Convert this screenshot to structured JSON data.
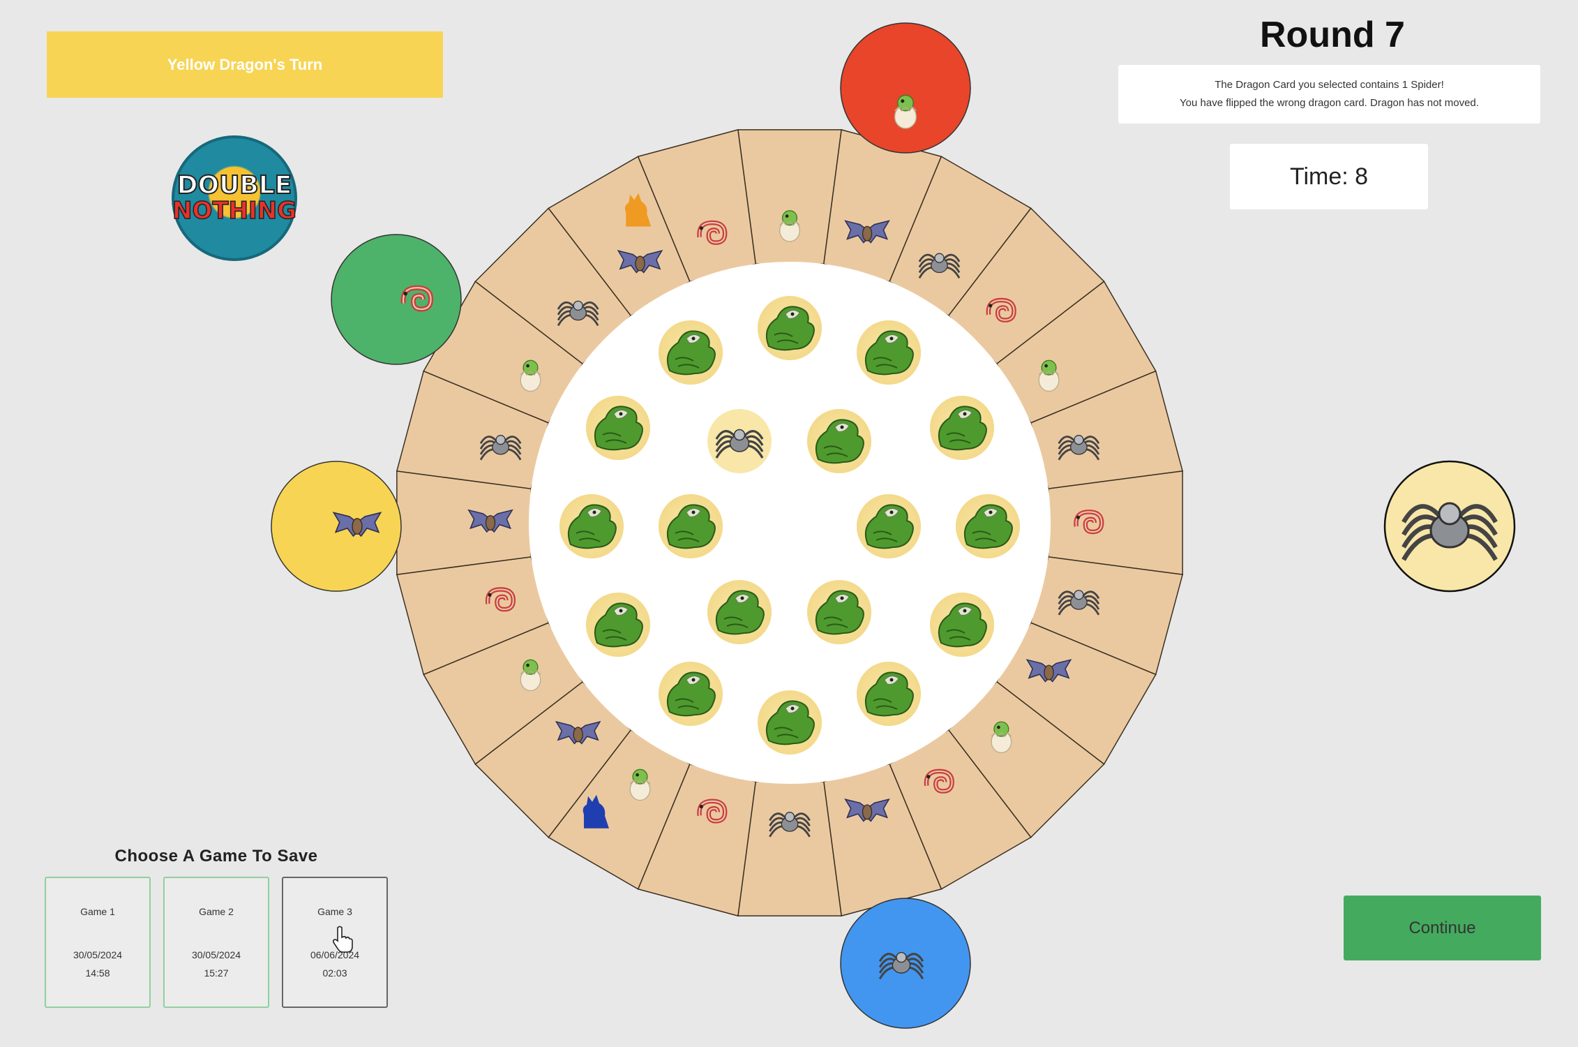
{
  "turn_banner": "Yellow Dragon's Turn",
  "round_title": "Round 7",
  "message": {
    "line1": "The Dragon Card you selected contains 1 Spider!",
    "line2": "You have flipped the wrong dragon card. Dragon has not moved."
  },
  "timer": "Time: 8",
  "continue_label": "Continue",
  "logo": {
    "line1": "DOUBLE",
    "line2": "NOTHING"
  },
  "save": {
    "title": "Choose A Game To Save",
    "games": [
      {
        "name": "Game 1",
        "date": "30/05/2024",
        "time": "14:58"
      },
      {
        "name": "Game 2",
        "date": "30/05/2024",
        "time": "15:27"
      },
      {
        "name": "Game 3",
        "date": "06/06/2024",
        "time": "02:03"
      }
    ]
  },
  "colors": {
    "background": "#e8e8e8",
    "banner_yellow": "#f7d453",
    "board_tile": "#ebc9a0",
    "red_player": "#e8452a",
    "green_player": "#4db36a",
    "yellow_player": "#f7d453",
    "blue_player": "#4296f0",
    "continue_green": "#44aa5e"
  },
  "board": {
    "ring_tiles": [
      "egg-icon",
      "bat-icon",
      "spider-icon",
      "chameleon-icon",
      "egg-icon",
      "spider-icon",
      "chameleon-icon",
      "spider-icon",
      "bat-icon",
      "egg-icon",
      "chameleon-icon",
      "bat-icon",
      "spider-icon",
      "chameleon-icon",
      "egg-icon",
      "bat-icon",
      "egg-icon",
      "chameleon-icon",
      "bat-icon",
      "spider-icon",
      "egg-icon",
      "spider-icon",
      "bat-icon",
      "chameleon-icon"
    ],
    "dragon_tokens": [
      {
        "name": "orange-dragon-token",
        "color": "#ef9a22",
        "ring_index": 22
      },
      {
        "name": "blue-dragon-token",
        "color": "#1f3fb0",
        "ring_index": 14
      }
    ],
    "caves": [
      {
        "name": "red-cave",
        "color": "#e8452a",
        "icon": "egg-icon"
      },
      {
        "name": "green-cave",
        "color": "#4db36a",
        "icon": "chameleon-icon"
      },
      {
        "name": "yellow-cave",
        "color": "#f7d453",
        "icon": "bat-icon"
      },
      {
        "name": "blue-cave",
        "color": "#4296f0",
        "icon": "spider-icon"
      }
    ],
    "center_cards": [
      "dragon-card-icon",
      "dragon-card-icon",
      "dragon-card-icon",
      "dragon-card-icon",
      "spider-icon",
      "dragon-card-icon",
      "dragon-card-icon",
      "dragon-card-icon",
      "dragon-card-icon",
      "dragon-card-icon",
      "dragon-card-icon",
      "dragon-card-icon",
      "dragon-card-icon",
      "dragon-card-icon",
      "dragon-card-icon",
      "dragon-card-icon",
      "dragon-card-icon",
      "dragon-card-icon"
    ],
    "revealed_card": "spider-icon"
  }
}
